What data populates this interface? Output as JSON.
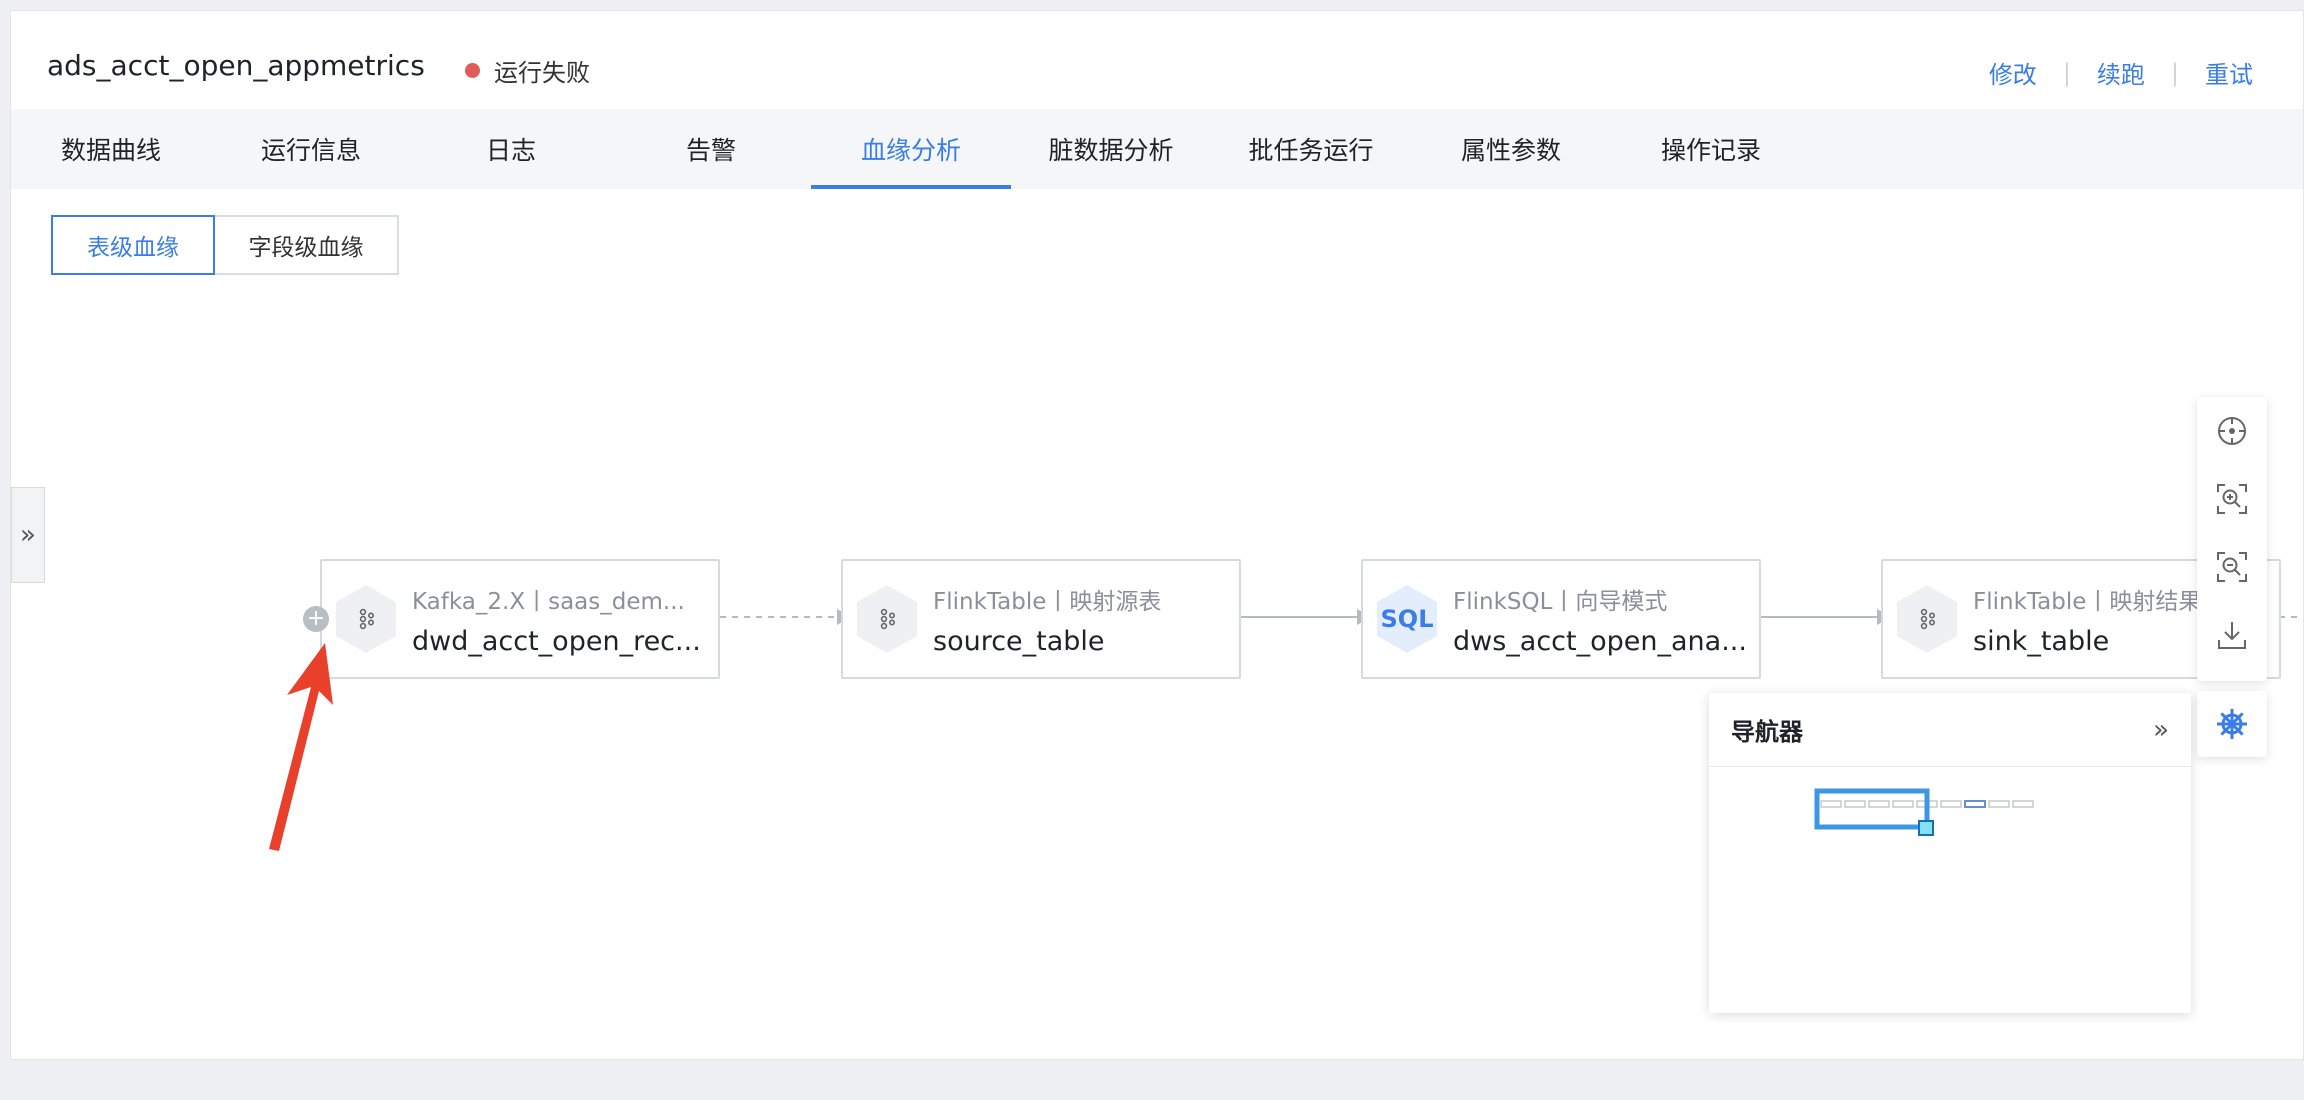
{
  "header": {
    "title": "ads_acct_open_appmetrics",
    "status_text": "运行失败",
    "status_color": "#e25c5c",
    "actions": [
      "修改",
      "续跑",
      "重试"
    ]
  },
  "tabs": [
    "数据曲线",
    "运行信息",
    "日志",
    "告警",
    "血缘分析",
    "脏数据分析",
    "批任务运行",
    "属性参数",
    "操作记录"
  ],
  "active_tab": "血缘分析",
  "lineage_toggle": {
    "table_level": "表级血缘",
    "field_level": "字段级血缘",
    "active": "表级血缘"
  },
  "nodes": [
    {
      "type": "Kafka_2.X丨saas_dem...",
      "name": "dwd_acct_open_rec...",
      "icon": "kafka-icon"
    },
    {
      "type": "FlinkTable丨映射源表",
      "name": "source_table",
      "icon": "kafka-icon"
    },
    {
      "type": "FlinkSQL丨向导模式",
      "name": "dws_acct_open_ana...",
      "icon": "sql-icon",
      "icon_text": "SQL"
    },
    {
      "type": "FlinkTable丨映射结果",
      "name": "sink_table",
      "icon": "kafka-icon"
    }
  ],
  "navigator": {
    "title": "导航器"
  },
  "toolbar": [
    "locate-icon",
    "zoom-in-icon",
    "zoom-out-icon",
    "download-icon"
  ],
  "colors": {
    "accent": "#3a7de8",
    "annotation_arrow": "#e8402a"
  }
}
